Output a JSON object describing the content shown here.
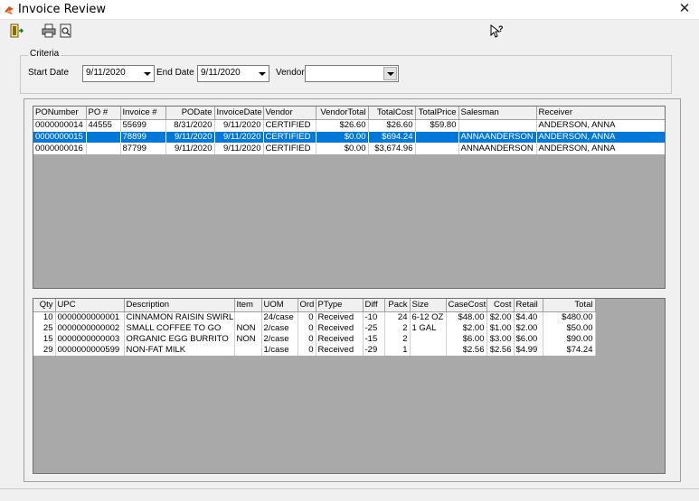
{
  "window": {
    "title": "Invoice Review",
    "close_glyph": "✕"
  },
  "toolbar": {
    "icons": [
      "exit-icon",
      "print-icon",
      "print-preview-icon",
      "help-icon"
    ]
  },
  "criteria": {
    "legend": "Criteria",
    "start_label": "Start Date",
    "start_value": "9/11/2020",
    "end_label": "End Date",
    "end_value": "9/11/2020",
    "vendor_label": "Vendor",
    "vendor_value": ""
  },
  "invoices": {
    "columns": [
      "PONumber",
      "PO #",
      "Invoice #",
      "PODate",
      "InvoiceDate",
      "Vendor",
      "VendorTotal",
      "TotalCost",
      "TotalPrice",
      "Salesman",
      "Receiver"
    ],
    "rows": [
      [
        "0000000014",
        "44555",
        "55699",
        "8/31/2020",
        "9/11/2020",
        "CERTIFIED",
        "$26.60",
        "$26.60",
        "$59.80",
        "",
        "ANDERSON, ANNA"
      ],
      [
        "0000000015",
        "",
        "78899",
        "9/11/2020",
        "9/11/2020",
        "CERTIFIED",
        "$0.00",
        "$694.24",
        "",
        "ANNAANDERSON",
        "ANDERSON, ANNA"
      ],
      [
        "0000000016",
        "",
        "87799",
        "9/11/2020",
        "9/11/2020",
        "CERTIFIED",
        "$0.00",
        "$3,674.96",
        "",
        "ANNAANDERSON",
        "ANDERSON, ANNA"
      ]
    ],
    "selected_row": 1
  },
  "items": {
    "columns": [
      "Qty",
      "UPC",
      "Description",
      "Item",
      "UOM",
      "Ord",
      "PType",
      "Diff",
      "Pack",
      "Size",
      "CaseCost",
      "Cost",
      "Retail",
      "Total"
    ],
    "rows": [
      [
        "10",
        "0000000000001",
        "CINNAMON RAISIN SWIRL",
        "",
        "24/case",
        "0",
        "Received",
        "-10",
        "24",
        "6-12 OZ",
        "$48.00",
        "$2.00",
        "$4.40",
        "$480.00"
      ],
      [
        "25",
        "0000000000002",
        "SMALL COFFEE TO GO",
        "NON",
        "2/case",
        "0",
        "Received",
        "-25",
        "2",
        "1 GAL",
        "$2.00",
        "$1.00",
        "$2.00",
        "$50.00"
      ],
      [
        "15",
        "0000000000003",
        "ORGANIC EGG BURRITO",
        "NON",
        "2/case",
        "0",
        "Received",
        "-15",
        "2",
        "",
        "$6.00",
        "$3.00",
        "$6.00",
        "$90.00"
      ],
      [
        "29",
        "0000000000599",
        "NON-FAT MILK",
        "",
        "1/case",
        "0",
        "Received",
        "-29",
        "1",
        "",
        "$2.56",
        "$2.56",
        "$4.99",
        "$74.24"
      ]
    ]
  }
}
